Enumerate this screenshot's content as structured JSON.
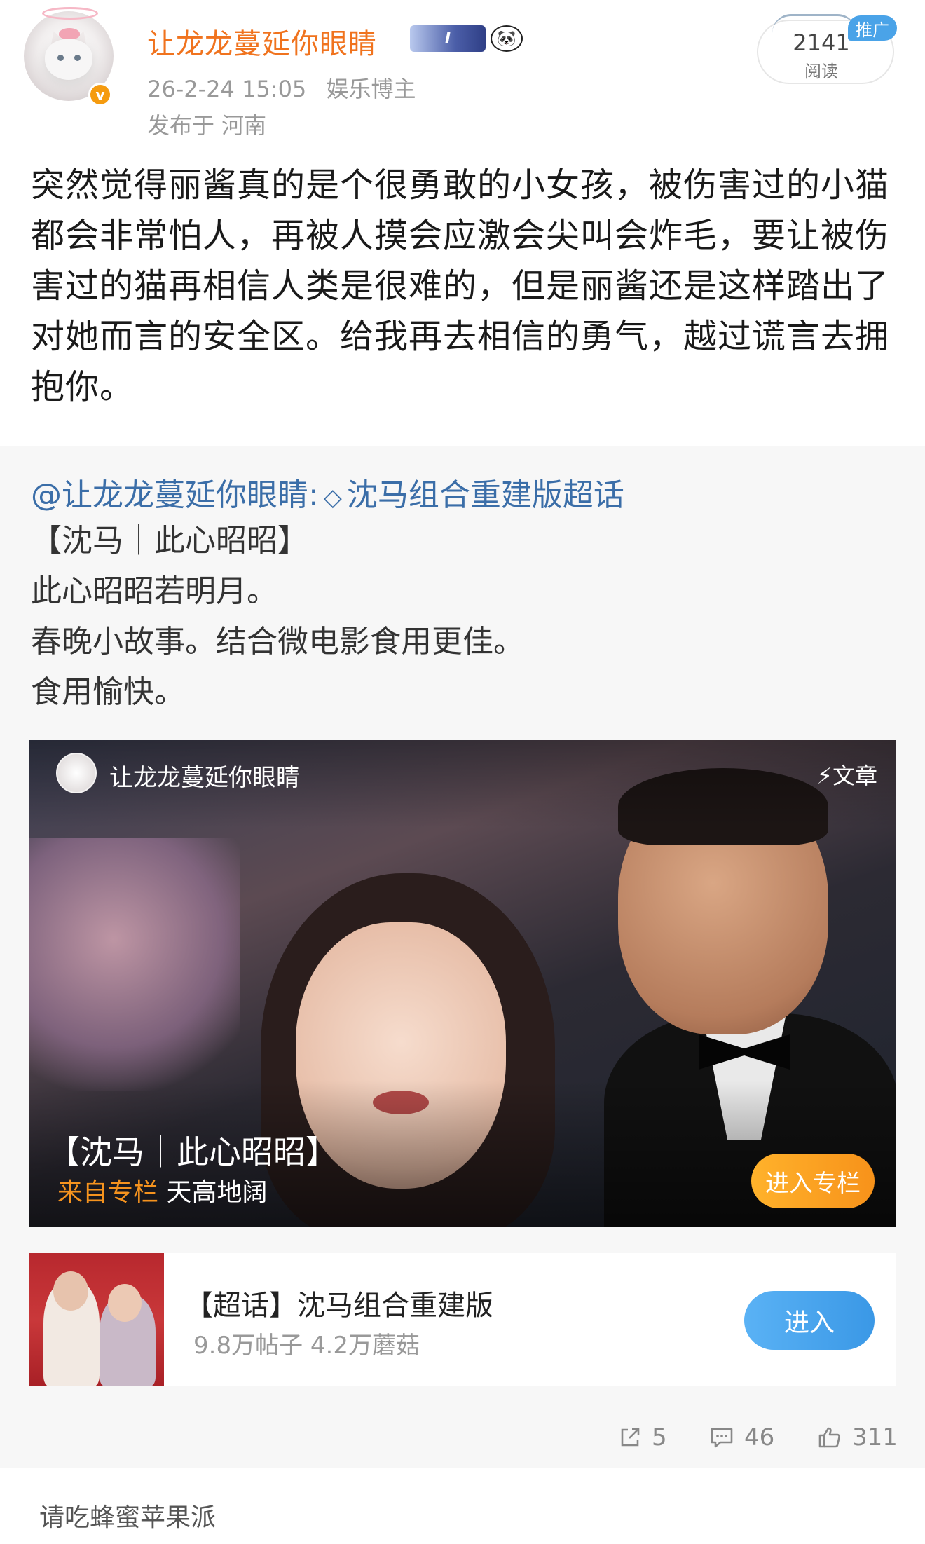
{
  "post": {
    "username": "让龙龙蔓延你眼睛",
    "verify_mark": "v",
    "level_badge": "I",
    "time": "26-2-24 15:05",
    "user_tag": "娱乐博主",
    "location": "发布于 河南",
    "read_count": "2141",
    "read_label": "阅读",
    "promo_tag": "推广",
    "text": "突然觉得丽酱真的是个很勇敢的小女孩，被伤害过的小猫都会非常怕人，再被人摸会应激会尖叫会炸毛，要让被伤害过的猫再相信人类是很难的，但是丽酱还是这样踏出了对她而言的安全区。给我再去相信的勇气，越过谎言去拥抱你。"
  },
  "repost": {
    "mention": "@让龙龙蔓延你眼睛:",
    "topic_link": "沈马组合重建版超话",
    "lines": [
      "【沈马｜此心昭昭】",
      "此心昭昭若明月。",
      "春晚小故事。结合微电影食用更佳。",
      "食用愉快。"
    ],
    "article": {
      "author": "让龙龙蔓延你眼睛",
      "type_label": "文章",
      "title": "【沈马｜此心昭昭】",
      "source_label": "来自专栏",
      "source_name": "天高地阔",
      "enter_label": "进入专栏"
    },
    "topic_card": {
      "title": "【超话】沈马组合重建版",
      "stats": "9.8万帖子 4.2万蘑菇",
      "enter_label": "进入"
    }
  },
  "actions": {
    "share_count": "5",
    "comment_count": "46",
    "like_count": "311"
  },
  "comment_preview": {
    "text": "请吃蜂蜜苹果派"
  },
  "colors": {
    "username": "#f0731e",
    "link": "#3b6ea8",
    "article_enter": "#f7921a",
    "topic_enter": "#3a98e6",
    "repost_bg": "#f7f7f7"
  },
  "icons": {
    "verify": "verified-badge-icon",
    "level": "level-badge-icon",
    "panda": "panda-badge-icon",
    "diamond": "diamond-icon",
    "bolt": "lightning-icon",
    "share": "share-icon",
    "comment": "comment-icon",
    "like": "like-icon"
  }
}
